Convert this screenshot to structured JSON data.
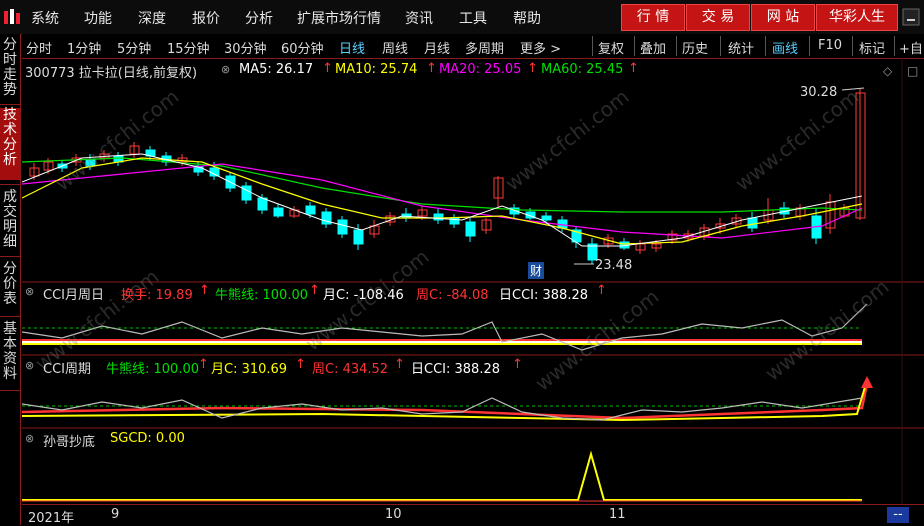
{
  "menu": {
    "items": [
      "系统",
      "功能",
      "深度",
      "报价",
      "分析",
      "扩展市场行情",
      "资讯",
      "工具",
      "帮助"
    ],
    "right_buttons": [
      "行 情",
      "交 易",
      "网 站",
      "华彩人生"
    ]
  },
  "periods": {
    "items": [
      "分时",
      "1分钟",
      "5分钟",
      "15分钟",
      "30分钟",
      "60分钟",
      "日线",
      "周线",
      "月线",
      "多周期",
      "更多 >"
    ],
    "active": "日线"
  },
  "tools": {
    "items": [
      "复权",
      "叠加",
      "历史",
      "统计",
      "画线",
      "F10",
      "标记",
      "+自"
    ],
    "active": "画线"
  },
  "sidebar": {
    "items": [
      "分时走势",
      "技术分析",
      "成交明细",
      "分价表",
      "基本资料"
    ],
    "active": "技术分析"
  },
  "main_pane": {
    "stock": "300773 拉卡拉(日线,前复权)",
    "ma": [
      {
        "label": "MA5: 26.17",
        "color": "#ffffff"
      },
      {
        "label": "MA10: 25.74",
        "color": "#ffff00"
      },
      {
        "label": "MA20: 25.05",
        "color": "#ff00ff"
      },
      {
        "label": "MA60: 25.45",
        "color": "#00e000"
      }
    ],
    "high_label": "30.28",
    "low_label": "23.48",
    "cai_badge": "财"
  },
  "cci_pane1": {
    "title": "CCI月周日",
    "items": [
      {
        "label": "换手: 19.89",
        "color": "#ff3333"
      },
      {
        "label": "牛熊线: 100.00",
        "color": "#00e000"
      },
      {
        "label": "月C: -108.46",
        "color": "#ffffff"
      },
      {
        "label": "周C: -84.08",
        "color": "#ff3333"
      },
      {
        "label": "日CCI: 388.28",
        "color": "#ffffff"
      }
    ]
  },
  "cci_pane2": {
    "title": "CCI周期",
    "items": [
      {
        "label": "牛熊线: 100.00",
        "color": "#00e000"
      },
      {
        "label": "月C: 310.69",
        "color": "#ffff00"
      },
      {
        "label": "周C: 434.52",
        "color": "#ff3333"
      },
      {
        "label": "日CCI: 388.28",
        "color": "#ffffff"
      }
    ]
  },
  "sgcd_pane": {
    "title": "孙哥抄底",
    "value": "SGCD: 0.00"
  },
  "axis": {
    "labels": [
      "2021年",
      "9",
      "10",
      "11"
    ],
    "corner": "--"
  },
  "watermark": "www.cfchi.com",
  "colors": {
    "up": "#ff3a3a",
    "down": "#00ffff",
    "accent": "#c41414"
  }
}
